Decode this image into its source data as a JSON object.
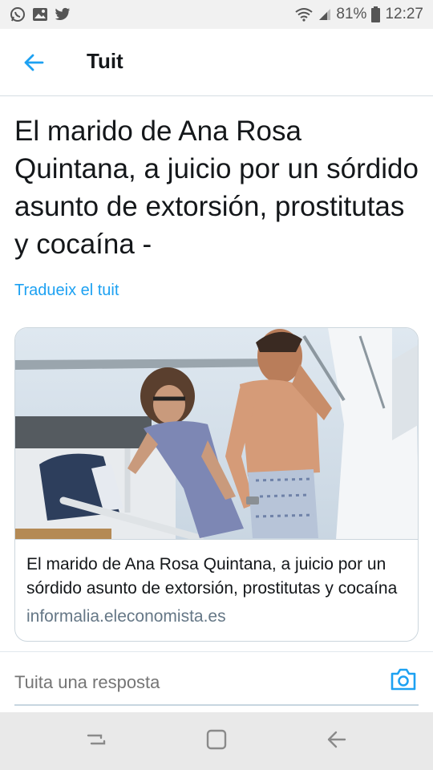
{
  "status_bar": {
    "left_icons": [
      "whatsapp-icon",
      "gallery-icon",
      "twitter-icon"
    ],
    "battery_percent": "81%",
    "time": "12:27"
  },
  "app_bar": {
    "back_icon": "arrow-left-icon",
    "title": "Tuit"
  },
  "tweet": {
    "text": "El marido de Ana Rosa Quintana, a juicio por un sórdido asunto de extorsión, prostitutas y cocaína -",
    "translate_label": "Tradueix el tuit"
  },
  "card": {
    "title": "El marido de Ana Rosa Quintana, a juicio por un sórdido asunto de extorsión, prostitutas y cocaína",
    "domain": "informalia.eleconomista.es"
  },
  "reply": {
    "placeholder": "Tuita una resposta",
    "camera_icon": "camera-icon"
  },
  "nav_bar": {
    "icons": [
      "recent-apps-icon",
      "home-icon",
      "back-icon"
    ]
  },
  "colors": {
    "accent": "#1da1f2",
    "secondary_text": "#657786",
    "status_bar_bg": "#f1f1f1",
    "nav_bar_bg": "#e9e9e9"
  }
}
